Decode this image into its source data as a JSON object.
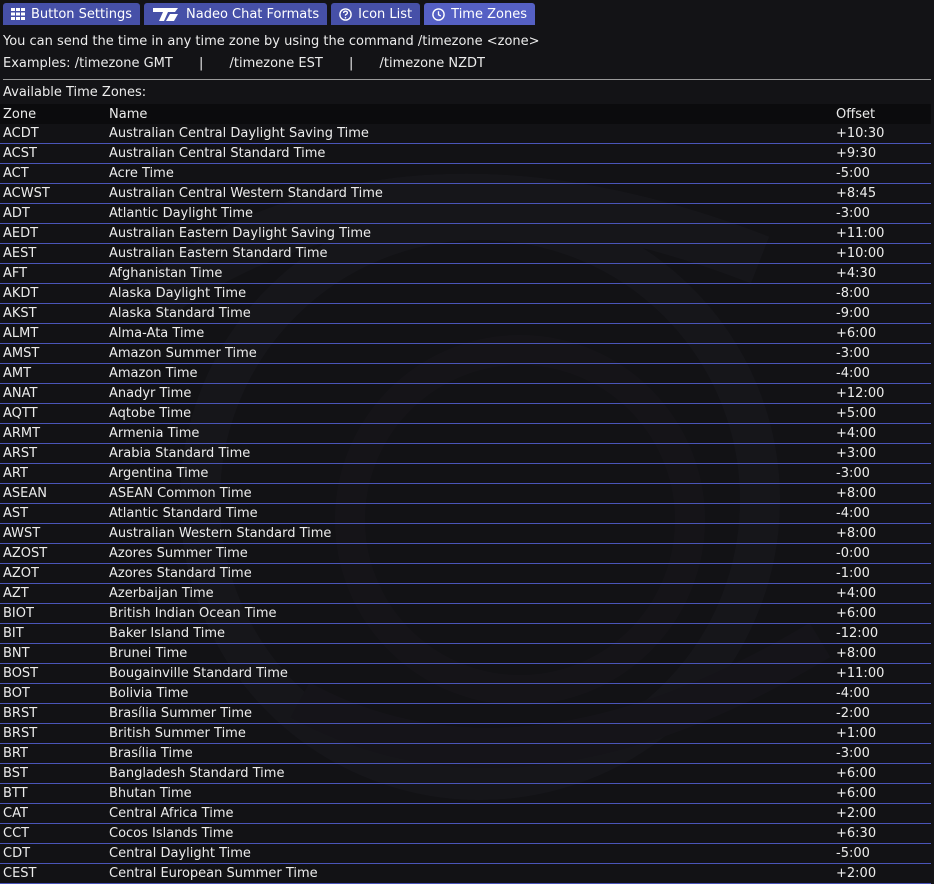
{
  "tabs": [
    {
      "label": "Button Settings",
      "icon": "grid-icon",
      "active": false
    },
    {
      "label": "Nadeo Chat Formats",
      "icon": "trackmania-logo-icon",
      "active": false
    },
    {
      "label": "Icon List",
      "icon": "help-circle-icon",
      "active": false
    },
    {
      "label": "Time Zones",
      "icon": "clock-icon",
      "active": true
    }
  ],
  "intro": {
    "description": "You can send the time in any time zone by using the command /timezone <zone>",
    "examples_label": "Examples:",
    "examples": [
      "/timezone GMT",
      "/timezone EST",
      "/timezone NZDT"
    ],
    "separator": "|"
  },
  "available_label": "Available Time Zones:",
  "table": {
    "headers": {
      "zone": "Zone",
      "name": "Name",
      "offset": "Offset"
    },
    "rows": [
      {
        "zone": "ACDT",
        "name": "Australian Central Daylight Saving Time",
        "offset": "+10:30"
      },
      {
        "zone": "ACST",
        "name": "Australian Central Standard Time",
        "offset": "+9:30"
      },
      {
        "zone": "ACT",
        "name": "Acre Time",
        "offset": "-5:00"
      },
      {
        "zone": "ACWST",
        "name": "Australian Central Western Standard Time",
        "offset": "+8:45"
      },
      {
        "zone": "ADT",
        "name": "Atlantic Daylight Time",
        "offset": "-3:00"
      },
      {
        "zone": "AEDT",
        "name": "Australian Eastern Daylight Saving Time",
        "offset": "+11:00"
      },
      {
        "zone": "AEST",
        "name": "Australian Eastern Standard Time",
        "offset": "+10:00"
      },
      {
        "zone": "AFT",
        "name": "Afghanistan Time",
        "offset": "+4:30"
      },
      {
        "zone": "AKDT",
        "name": "Alaska Daylight Time",
        "offset": "-8:00"
      },
      {
        "zone": "AKST",
        "name": "Alaska Standard Time",
        "offset": "-9:00"
      },
      {
        "zone": "ALMT",
        "name": "Alma-Ata Time",
        "offset": "+6:00"
      },
      {
        "zone": "AMST",
        "name": "Amazon Summer Time",
        "offset": "-3:00"
      },
      {
        "zone": "AMT",
        "name": "Amazon Time",
        "offset": "-4:00"
      },
      {
        "zone": "ANAT",
        "name": "Anadyr Time",
        "offset": "+12:00"
      },
      {
        "zone": "AQTT",
        "name": "Aqtobe Time",
        "offset": "+5:00"
      },
      {
        "zone": "ARMT",
        "name": "Armenia Time",
        "offset": "+4:00"
      },
      {
        "zone": "ARST",
        "name": "Arabia Standard Time",
        "offset": "+3:00"
      },
      {
        "zone": "ART",
        "name": "Argentina Time",
        "offset": "-3:00"
      },
      {
        "zone": "ASEAN",
        "name": "ASEAN Common Time",
        "offset": "+8:00"
      },
      {
        "zone": "AST",
        "name": "Atlantic Standard Time",
        "offset": "-4:00"
      },
      {
        "zone": "AWST",
        "name": "Australian Western Standard Time",
        "offset": "+8:00"
      },
      {
        "zone": "AZOST",
        "name": "Azores Summer Time",
        "offset": "-0:00"
      },
      {
        "zone": "AZOT",
        "name": "Azores Standard Time",
        "offset": "-1:00"
      },
      {
        "zone": "AZT",
        "name": "Azerbaijan Time",
        "offset": "+4:00"
      },
      {
        "zone": "BIOT",
        "name": "British Indian Ocean Time",
        "offset": "+6:00"
      },
      {
        "zone": "BIT",
        "name": "Baker Island Time",
        "offset": "-12:00"
      },
      {
        "zone": "BNT",
        "name": "Brunei Time",
        "offset": "+8:00"
      },
      {
        "zone": "BOST",
        "name": "Bougainville Standard Time",
        "offset": "+11:00"
      },
      {
        "zone": "BOT",
        "name": "Bolivia Time",
        "offset": "-4:00"
      },
      {
        "zone": "BRST",
        "name": "Brasília Summer Time",
        "offset": "-2:00"
      },
      {
        "zone": "BRST",
        "name": "British Summer Time",
        "offset": "+1:00"
      },
      {
        "zone": "BRT",
        "name": "Brasília Time",
        "offset": "-3:00"
      },
      {
        "zone": "BST",
        "name": "Bangladesh Standard Time",
        "offset": "+6:00"
      },
      {
        "zone": "BTT",
        "name": "Bhutan Time",
        "offset": "+6:00"
      },
      {
        "zone": "CAT",
        "name": "Central Africa Time",
        "offset": "+2:00"
      },
      {
        "zone": "CCT",
        "name": "Cocos Islands Time",
        "offset": "+6:30"
      },
      {
        "zone": "CDT",
        "name": "Central Daylight Time",
        "offset": "-5:00"
      },
      {
        "zone": "CEST",
        "name": "Central European Summer Time",
        "offset": "+2:00"
      }
    ]
  },
  "colors": {
    "background": "#131316",
    "tab": "#4650a8",
    "tab_active": "#5560c4",
    "row_divider": "#4a55b8",
    "header_background": "#0b0b0d",
    "text": "#ececec"
  }
}
